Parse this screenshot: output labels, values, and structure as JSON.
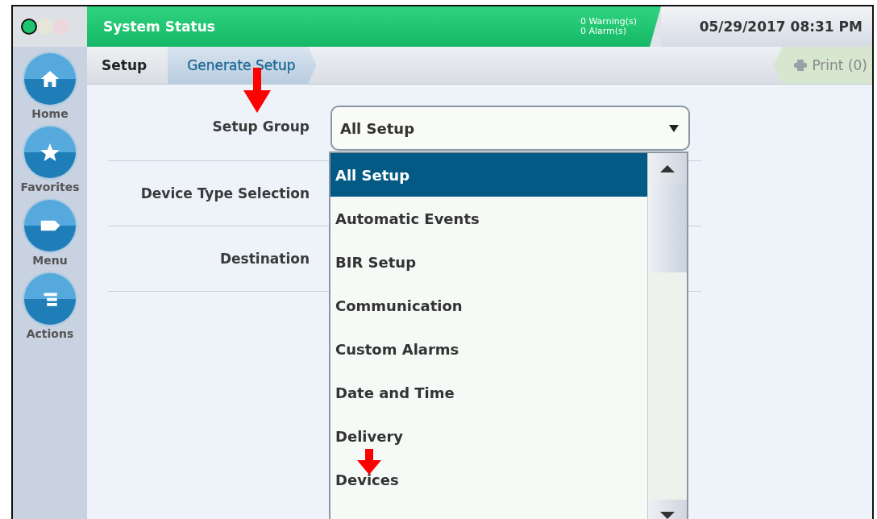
{
  "window_lights": [
    {
      "color": "#1ec46e",
      "on": true
    },
    {
      "color": "#e6e6d8",
      "on": false
    },
    {
      "color": "#ecd8dc",
      "on": false
    }
  ],
  "header": {
    "title": "System Status",
    "warnings": "0 Warning(s)",
    "alarms": "0 Alarm(s)",
    "datetime": "05/29/2017 08:31 PM"
  },
  "sidebar": {
    "items": [
      {
        "label": "Home",
        "kind": "home"
      },
      {
        "label": "Favorites",
        "kind": "star"
      },
      {
        "label": "Menu",
        "kind": "tag"
      },
      {
        "label": "Actions",
        "kind": "lines"
      }
    ]
  },
  "breadcrumbs": [
    {
      "label": "Setup",
      "selected": false
    },
    {
      "label": "Generate Setup",
      "selected": true
    }
  ],
  "print_button": {
    "label": "Print (0)",
    "disabled": true
  },
  "form": {
    "fields": [
      {
        "label": "Setup Group",
        "kind": "dropdown",
        "value": "All Setup"
      },
      {
        "label": "Device Type Selection",
        "kind": "empty"
      },
      {
        "label": "Destination",
        "kind": "empty"
      }
    ]
  },
  "dropdown_list": {
    "items": [
      {
        "label": "All Setup",
        "selected": true
      },
      {
        "label": "Automatic Events",
        "selected": false
      },
      {
        "label": "BIR Setup",
        "selected": false
      },
      {
        "label": "Communication",
        "selected": false
      },
      {
        "label": "Custom Alarms",
        "selected": false
      },
      {
        "label": "Date and Time",
        "selected": false
      },
      {
        "label": "Delivery",
        "selected": false
      },
      {
        "label": "Devices",
        "selected": false
      }
    ]
  }
}
